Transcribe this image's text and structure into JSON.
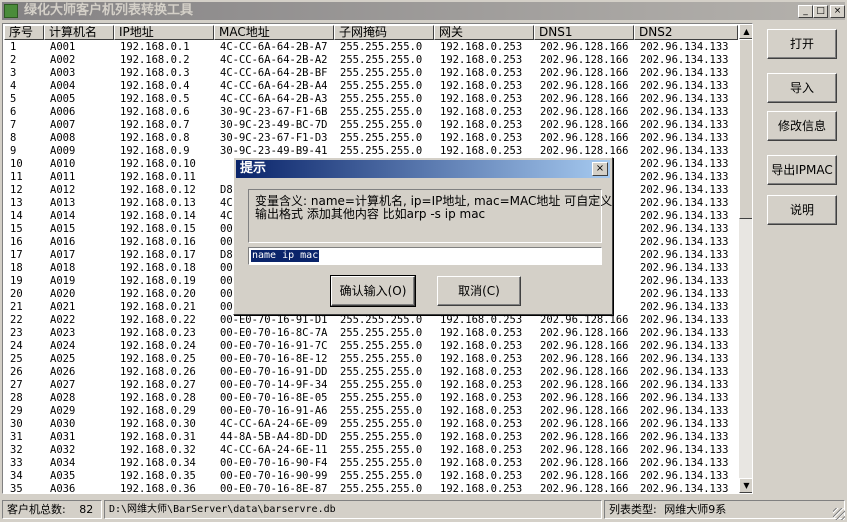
{
  "window": {
    "title": "绿化大师客户机列表转换工具",
    "minimize": "_",
    "maximize": "□",
    "close": "×"
  },
  "table": {
    "columns": [
      "序号",
      "计算机名",
      "IP地址",
      "MAC地址",
      "子网掩码",
      "网关",
      "DNS1",
      "DNS2"
    ],
    "rows": [
      [
        "1",
        "A001",
        "192.168.0.1",
        "4C-CC-6A-64-2B-A7",
        "255.255.255.0",
        "192.168.0.253",
        "202.96.128.166",
        "202.96.134.133"
      ],
      [
        "2",
        "A002",
        "192.168.0.2",
        "4C-CC-6A-64-2B-A2",
        "255.255.255.0",
        "192.168.0.253",
        "202.96.128.166",
        "202.96.134.133"
      ],
      [
        "3",
        "A003",
        "192.168.0.3",
        "4C-CC-6A-64-2B-BF",
        "255.255.255.0",
        "192.168.0.253",
        "202.96.128.166",
        "202.96.134.133"
      ],
      [
        "4",
        "A004",
        "192.168.0.4",
        "4C-CC-6A-64-2B-A4",
        "255.255.255.0",
        "192.168.0.253",
        "202.96.128.166",
        "202.96.134.133"
      ],
      [
        "5",
        "A005",
        "192.168.0.5",
        "4C-CC-6A-64-2B-A3",
        "255.255.255.0",
        "192.168.0.253",
        "202.96.128.166",
        "202.96.134.133"
      ],
      [
        "6",
        "A006",
        "192.168.0.6",
        "30-9C-23-67-F1-6B",
        "255.255.255.0",
        "192.168.0.253",
        "202.96.128.166",
        "202.96.134.133"
      ],
      [
        "7",
        "A007",
        "192.168.0.7",
        "30-9C-23-49-BC-7D",
        "255.255.255.0",
        "192.168.0.253",
        "202.96.128.166",
        "202.96.134.133"
      ],
      [
        "8",
        "A008",
        "192.168.0.8",
        "30-9C-23-67-F1-D3",
        "255.255.255.0",
        "192.168.0.253",
        "202.96.128.166",
        "202.96.134.133"
      ],
      [
        "9",
        "A009",
        "192.168.0.9",
        "30-9C-23-49-B9-41",
        "255.255.255.0",
        "192.168.0.253",
        "202.96.128.166",
        "202.96.134.133"
      ],
      [
        "10",
        "A010",
        "192.168.0.10",
        "",
        "",
        "",
        "",
        "202.96.134.133"
      ],
      [
        "11",
        "A011",
        "192.168.0.11",
        "",
        "",
        "",
        "",
        "202.96.134.133"
      ],
      [
        "12",
        "A012",
        "192.168.0.12",
        "D8",
        "",
        "",
        "",
        "202.96.134.133"
      ],
      [
        "13",
        "A013",
        "192.168.0.13",
        "4C",
        "",
        "",
        "",
        "202.96.134.133"
      ],
      [
        "14",
        "A014",
        "192.168.0.14",
        "4C",
        "",
        "",
        "",
        "202.96.134.133"
      ],
      [
        "15",
        "A015",
        "192.168.0.15",
        "00",
        "",
        "",
        "",
        "202.96.134.133"
      ],
      [
        "16",
        "A016",
        "192.168.0.16",
        "00",
        "",
        "",
        "",
        "202.96.134.133"
      ],
      [
        "17",
        "A017",
        "192.168.0.17",
        "D8",
        "",
        "",
        "",
        "202.96.134.133"
      ],
      [
        "18",
        "A018",
        "192.168.0.18",
        "00",
        "",
        "",
        "",
        "202.96.134.133"
      ],
      [
        "19",
        "A019",
        "192.168.0.19",
        "00",
        "",
        "",
        "",
        "202.96.134.133"
      ],
      [
        "20",
        "A020",
        "192.168.0.20",
        "00",
        "",
        "",
        "",
        "202.96.134.133"
      ],
      [
        "21",
        "A021",
        "192.168.0.21",
        "00",
        "",
        "",
        "",
        "202.96.134.133"
      ],
      [
        "22",
        "A022",
        "192.168.0.22",
        "00-E0-70-16-91-D1",
        "255.255.255.0",
        "192.168.0.253",
        "202.96.128.166",
        "202.96.134.133"
      ],
      [
        "23",
        "A023",
        "192.168.0.23",
        "00-E0-70-16-8C-7A",
        "255.255.255.0",
        "192.168.0.253",
        "202.96.128.166",
        "202.96.134.133"
      ],
      [
        "24",
        "A024",
        "192.168.0.24",
        "00-E0-70-16-91-7C",
        "255.255.255.0",
        "192.168.0.253",
        "202.96.128.166",
        "202.96.134.133"
      ],
      [
        "25",
        "A025",
        "192.168.0.25",
        "00-E0-70-16-8E-12",
        "255.255.255.0",
        "192.168.0.253",
        "202.96.128.166",
        "202.96.134.133"
      ],
      [
        "26",
        "A026",
        "192.168.0.26",
        "00-E0-70-16-91-DD",
        "255.255.255.0",
        "192.168.0.253",
        "202.96.128.166",
        "202.96.134.133"
      ],
      [
        "27",
        "A027",
        "192.168.0.27",
        "00-E0-70-14-9F-34",
        "255.255.255.0",
        "192.168.0.253",
        "202.96.128.166",
        "202.96.134.133"
      ],
      [
        "28",
        "A028",
        "192.168.0.28",
        "00-E0-70-16-8E-05",
        "255.255.255.0",
        "192.168.0.253",
        "202.96.128.166",
        "202.96.134.133"
      ],
      [
        "29",
        "A029",
        "192.168.0.29",
        "00-E0-70-16-91-A6",
        "255.255.255.0",
        "192.168.0.253",
        "202.96.128.166",
        "202.96.134.133"
      ],
      [
        "30",
        "A030",
        "192.168.0.30",
        "4C-CC-6A-24-6E-09",
        "255.255.255.0",
        "192.168.0.253",
        "202.96.128.166",
        "202.96.134.133"
      ],
      [
        "31",
        "A031",
        "192.168.0.31",
        "44-8A-5B-A4-8D-DD",
        "255.255.255.0",
        "192.168.0.253",
        "202.96.128.166",
        "202.96.134.133"
      ],
      [
        "32",
        "A032",
        "192.168.0.32",
        "4C-CC-6A-24-6E-11",
        "255.255.255.0",
        "192.168.0.253",
        "202.96.128.166",
        "202.96.134.133"
      ],
      [
        "33",
        "A034",
        "192.168.0.34",
        "00-E0-70-16-90-F4",
        "255.255.255.0",
        "192.168.0.253",
        "202.96.128.166",
        "202.96.134.133"
      ],
      [
        "34",
        "A035",
        "192.168.0.35",
        "00-E0-70-16-90-99",
        "255.255.255.0",
        "192.168.0.253",
        "202.96.128.166",
        "202.96.134.133"
      ],
      [
        "35",
        "A036",
        "192.168.0.36",
        "00-E0-70-16-8E-87",
        "255.255.255.0",
        "192.168.0.253",
        "202.96.128.166",
        "202.96.134.133"
      ]
    ]
  },
  "buttons": {
    "open": "打开",
    "import": "导入",
    "modify": "修改信息",
    "export": "导出IPMAC",
    "help": "说明"
  },
  "status": {
    "count_label": "客户机总数:",
    "count": "82",
    "path": "D:\\网维大师\\BarServer\\data\\barservre.db",
    "type_label": "列表类型:",
    "type_value": "网维大师9系"
  },
  "dialog": {
    "title": "提示",
    "close": "×",
    "message_line1": "变量含义: name=计算机名, ip=IP地址, mac=MAC地址 可自定义",
    "message_line2": "输出格式 添加其他内容 比如arp -s ip mac",
    "input_value": "name ip mac",
    "ok": "确认输入(O)",
    "cancel": "取消(C)"
  }
}
